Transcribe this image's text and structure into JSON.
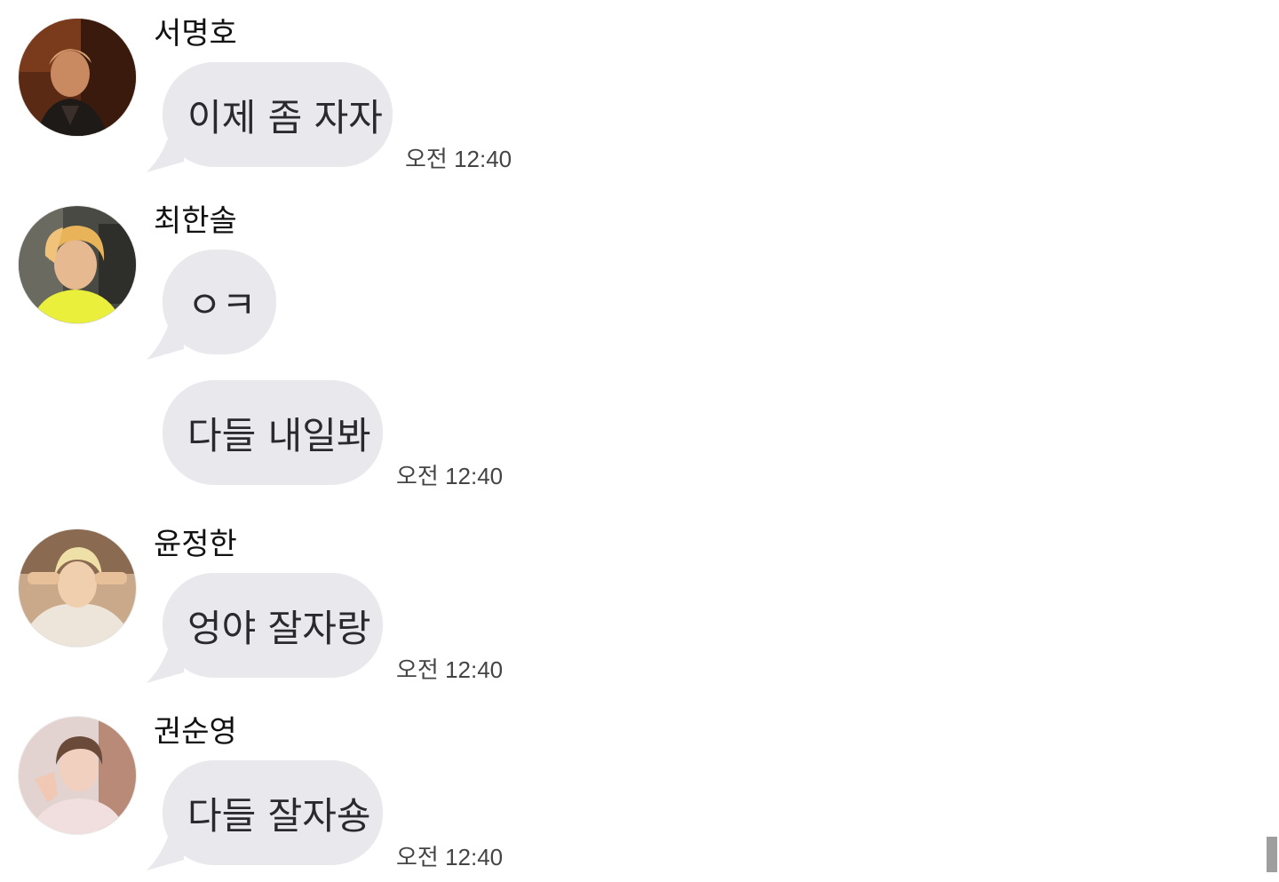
{
  "colors": {
    "bubble_background": "#e8e8ed",
    "bubble_text": "#2a2a2e",
    "name_text": "#111111",
    "timestamp_text": "#444444",
    "scrollbar": "#9e9e9e"
  },
  "messages": [
    {
      "sender": "서명호",
      "avatar_icon": "profile-photo-avatar",
      "bubbles": [
        {
          "text": "이제 좀 자자",
          "timestamp": "오전 12:40"
        }
      ]
    },
    {
      "sender": "최한솔",
      "avatar_icon": "profile-photo-avatar",
      "bubbles": [
        {
          "text": "ㅇㅋ",
          "timestamp": ""
        },
        {
          "text": "다들 내일봐",
          "timestamp": "오전 12:40"
        }
      ]
    },
    {
      "sender": "윤정한",
      "avatar_icon": "profile-photo-avatar",
      "bubbles": [
        {
          "text": "엉야 잘자랑",
          "timestamp": "오전 12:40"
        }
      ]
    },
    {
      "sender": "권순영",
      "avatar_icon": "profile-photo-avatar",
      "bubbles": [
        {
          "text": "다들 잘자숑",
          "timestamp": "오전 12:40"
        }
      ]
    }
  ]
}
